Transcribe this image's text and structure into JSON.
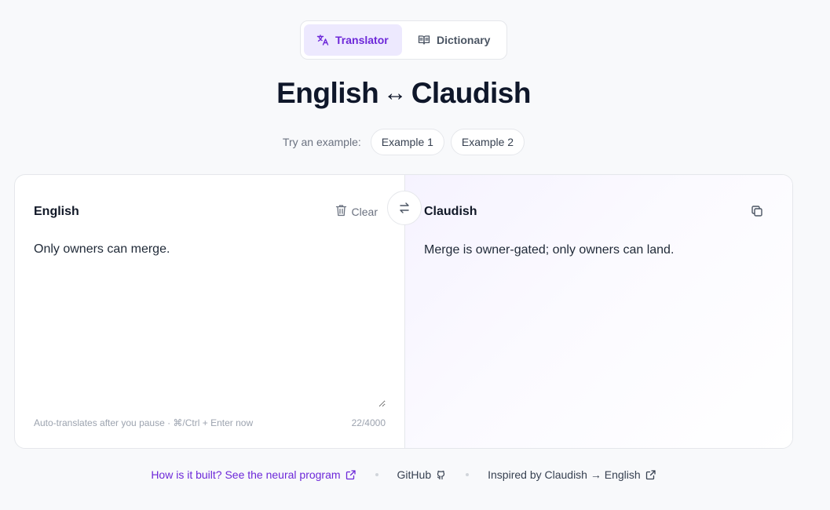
{
  "tabs": {
    "translator_label": "Translator",
    "dictionary_label": "Dictionary"
  },
  "title": {
    "left": "English",
    "arrow": "↔",
    "right": "Claudish"
  },
  "examples": {
    "label": "Try an example:",
    "items": [
      "Example 1",
      "Example 2"
    ]
  },
  "source": {
    "language": "English",
    "clear_label": "Clear",
    "text": "Only owners can merge.",
    "hint": "Auto-translates after you pause · ⌘/Ctrl + Enter now",
    "char_count": "22/4000"
  },
  "target": {
    "language": "Claudish",
    "text": "Merge is owner-gated; only owners can land."
  },
  "footer": {
    "neural_link": "How is it built? See the neural program",
    "github_link": "GitHub",
    "inspired_link": "Inspired by Claudish → English"
  },
  "colors": {
    "accent": "#6d28d9",
    "accent_bg": "#ede9fe",
    "border": "#e5e7eb",
    "muted": "#9ca3af"
  },
  "icons": {
    "translator": "translate-icon",
    "dictionary": "book-open-icon",
    "clear": "trash-icon",
    "swap": "swap-icon",
    "copy": "copy-icon",
    "external": "external-link-icon",
    "github": "github-icon"
  }
}
